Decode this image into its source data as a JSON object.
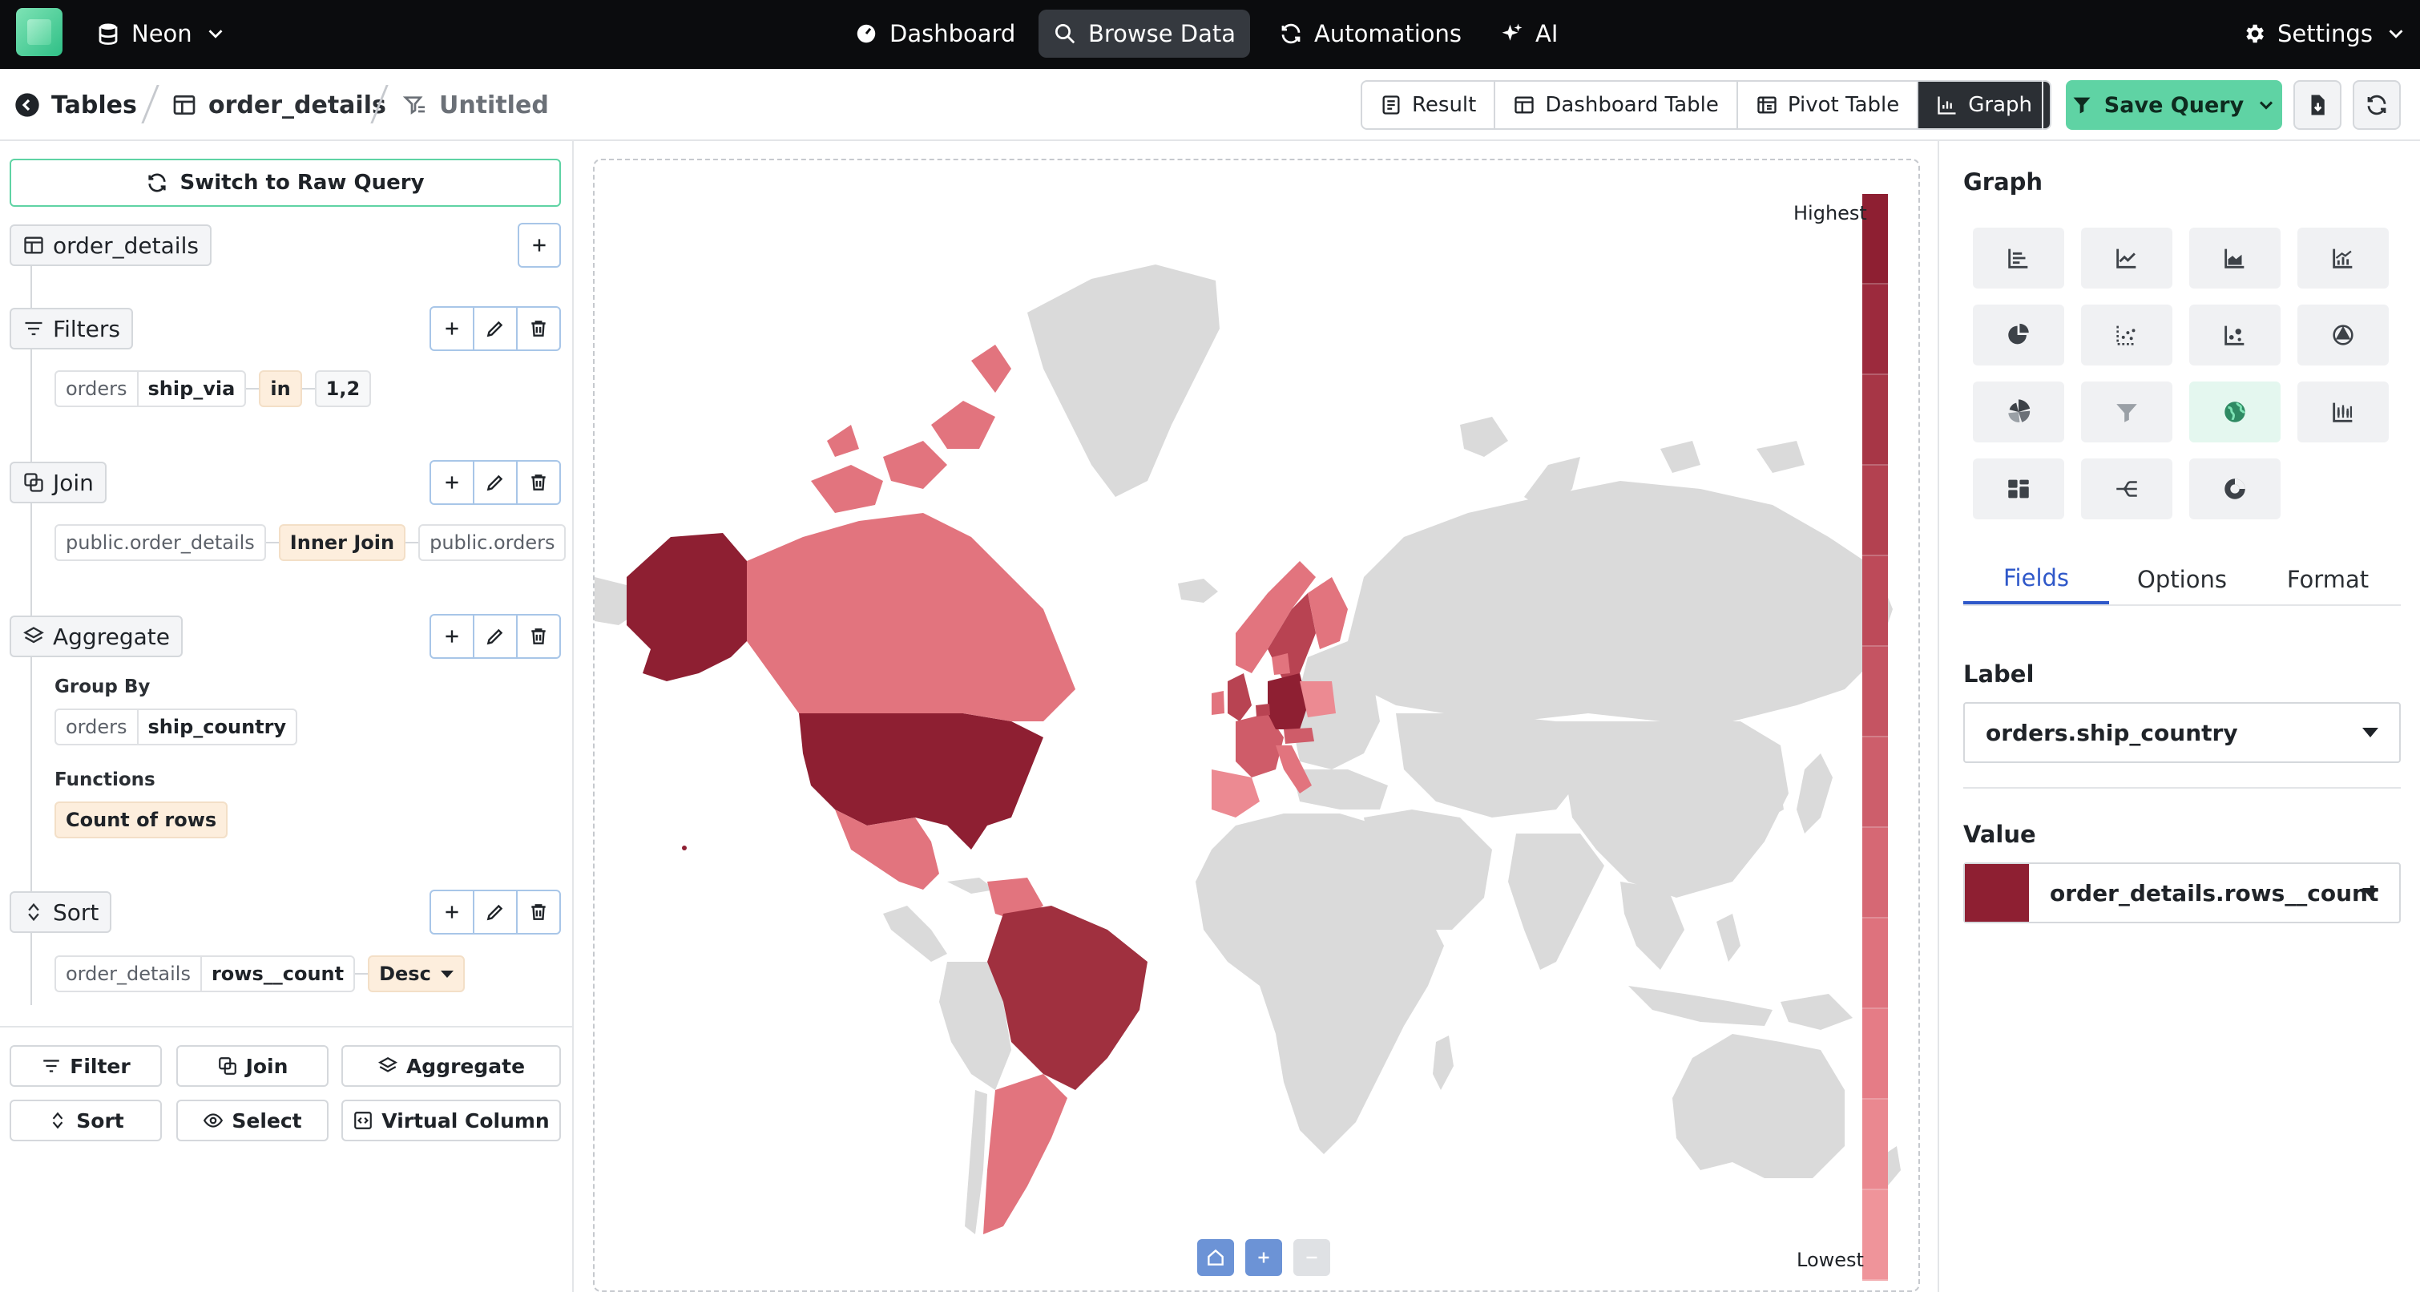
{
  "nav": {
    "workspace": "Neon",
    "items": [
      "Dashboard",
      "Browse Data",
      "Automations",
      "AI"
    ],
    "active": "Browse Data",
    "settings": "Settings"
  },
  "breadcrumb": {
    "tables": "Tables",
    "table": "order_details",
    "query": "Untitled"
  },
  "view_tabs": [
    "Result",
    "Dashboard Table",
    "Pivot Table",
    "Graph"
  ],
  "active_view": "Graph",
  "save_label": "Save Query",
  "left": {
    "raw_query_btn": "Switch to Raw Query",
    "source": "order_details",
    "filters": {
      "title": "Filters",
      "table": "orders",
      "column": "ship_via",
      "operator": "in",
      "value": "1,2"
    },
    "join": {
      "title": "Join",
      "left": "public.order_details",
      "type": "Inner Join",
      "right": "public.orders"
    },
    "aggregate": {
      "title": "Aggregate",
      "group_by_label": "Group By",
      "group_table": "orders",
      "group_column": "ship_country",
      "functions_label": "Functions",
      "function": "Count of rows"
    },
    "sort": {
      "title": "Sort",
      "table": "order_details",
      "column": "rows__count",
      "direction": "Desc"
    },
    "bottom_buttons": [
      "Filter",
      "Join",
      "Aggregate",
      "Sort",
      "Select",
      "Virtual Column"
    ]
  },
  "map": {
    "legend_high": "Highest",
    "legend_low": "Lowest",
    "legend_colors": [
      "#8e1f32",
      "#9c2a3d",
      "#a73646",
      "#b34150",
      "#bd4a59",
      "#c55462",
      "#cd5e6b",
      "#d66874",
      "#de727d",
      "#e57c86",
      "#ea8890",
      "#ef949a"
    ],
    "colors": {
      "none": "#dadada",
      "top": "#8e1f32",
      "high": "#a0303f",
      "mid": "#b84352",
      "midlow": "#cf5c69",
      "low": "#e2747e",
      "lowest": "#ec8a92"
    }
  },
  "right": {
    "title": "Graph",
    "tabs": [
      "Fields",
      "Options",
      "Format"
    ],
    "active_tab": "Fields",
    "label_title": "Label",
    "label_value": "orders.ship_country",
    "value_title": "Value",
    "value_value": "order_details.rows__count",
    "value_color": "#8e1f32",
    "graph_types": [
      "bar-horizontal",
      "line",
      "area",
      "combo",
      "pie",
      "scatter",
      "bubble",
      "radar",
      "polar",
      "funnel",
      "map",
      "candlestick",
      "treemap",
      "sankey",
      "gauge"
    ],
    "active_graph": "map"
  }
}
